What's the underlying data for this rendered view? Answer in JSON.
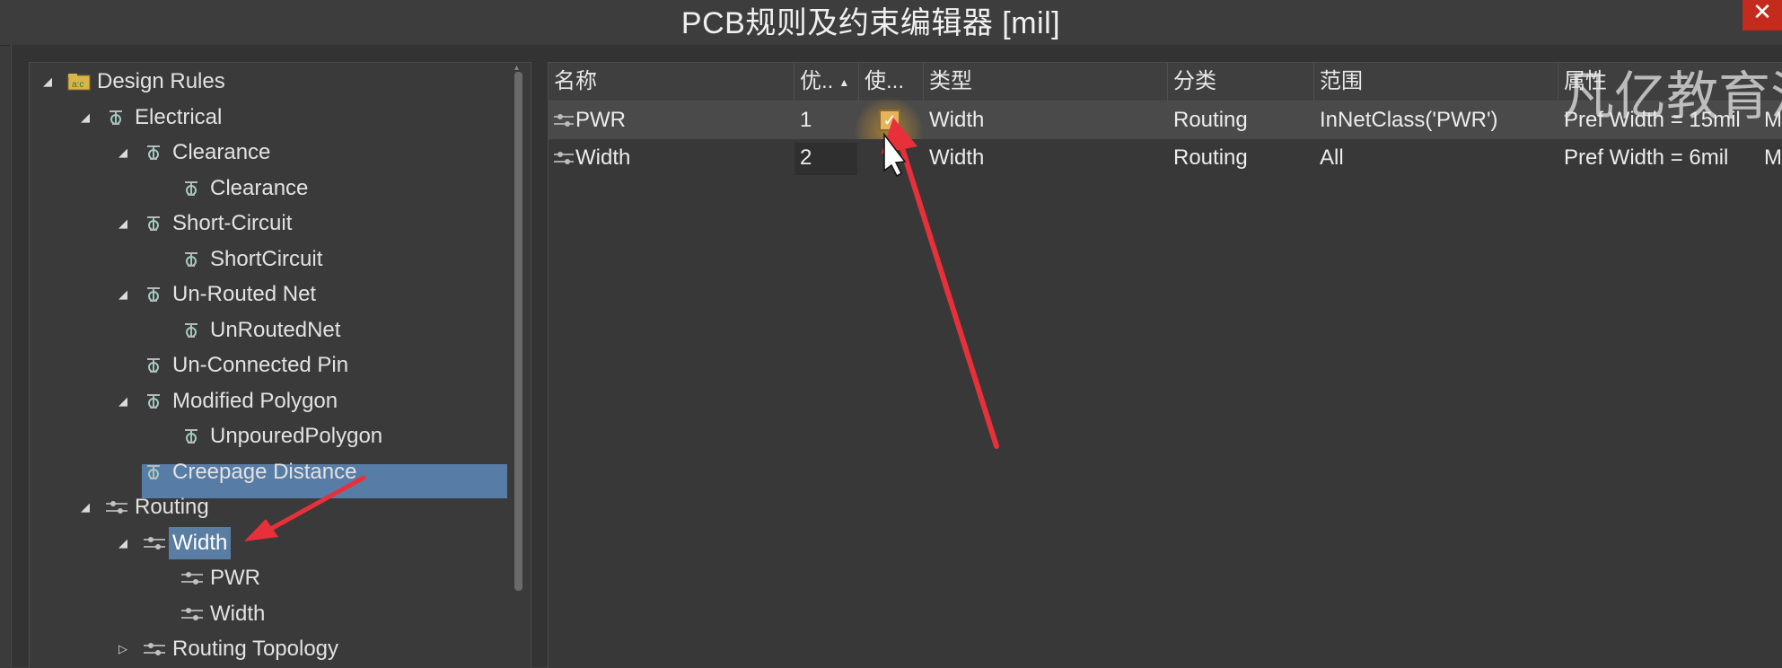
{
  "window": {
    "title": "PCB规则及约束编辑器 [mil]",
    "close_glyph": "✕"
  },
  "tree": {
    "items": [
      {
        "label": "Design Rules",
        "level": 0,
        "expanded": true,
        "icon": "design-rules-folder-icon"
      },
      {
        "label": "Electrical",
        "level": 1,
        "expanded": true,
        "icon": "rule-icon"
      },
      {
        "label": "Clearance",
        "level": 2,
        "expanded": true,
        "icon": "rule-icon"
      },
      {
        "label": "Clearance",
        "level": 3,
        "icon": "rule-icon"
      },
      {
        "label": "Short-Circuit",
        "level": 2,
        "expanded": true,
        "icon": "rule-icon"
      },
      {
        "label": "ShortCircuit",
        "level": 3,
        "icon": "rule-icon"
      },
      {
        "label": "Un-Routed Net",
        "level": 2,
        "expanded": true,
        "icon": "rule-icon"
      },
      {
        "label": "UnRoutedNet",
        "level": 3,
        "icon": "rule-icon"
      },
      {
        "label": "Un-Connected Pin",
        "level": 2,
        "icon": "rule-icon"
      },
      {
        "label": "Modified Polygon",
        "level": 2,
        "expanded": true,
        "icon": "rule-icon"
      },
      {
        "label": "UnpouredPolygon",
        "level": 3,
        "icon": "rule-icon"
      },
      {
        "label": "Creepage Distance",
        "level": 2,
        "icon": "rule-icon"
      },
      {
        "label": "Routing",
        "level": 1,
        "expanded": true,
        "icon": "routing-rule-icon"
      },
      {
        "label": "Width",
        "level": 2,
        "expanded": true,
        "selected": true,
        "icon": "routing-rule-icon"
      },
      {
        "label": "PWR",
        "level": 3,
        "icon": "routing-rule-icon"
      },
      {
        "label": "Width",
        "level": 3,
        "icon": "routing-rule-icon"
      },
      {
        "label": "Routing Topology",
        "level": 2,
        "expanded": false,
        "icon": "routing-rule-icon"
      }
    ]
  },
  "grid": {
    "columns": [
      {
        "label": "名称"
      },
      {
        "label": "优..",
        "sort": "▲"
      },
      {
        "label": "使..."
      },
      {
        "label": "类型"
      },
      {
        "label": "分类"
      },
      {
        "label": "范围"
      },
      {
        "label": "属性"
      }
    ],
    "rows": [
      {
        "name": "PWR",
        "priority": "1",
        "enabled": true,
        "type": "Width",
        "category": "Routing",
        "scope": "InNetClass('PWR')",
        "attributes": "Pref Width = 15mil",
        "extra": "M"
      },
      {
        "name": "Width",
        "priority": "2",
        "enabled": true,
        "type": "Width",
        "category": "Routing",
        "scope": "All",
        "attributes": "Pref Width = 6mil",
        "extra": "M"
      }
    ]
  },
  "watermark": "凡亿教育活",
  "colors": {
    "selection": "#577ca5",
    "annotation_arrow": "#e8303a",
    "close_button": "#c42b1c"
  }
}
